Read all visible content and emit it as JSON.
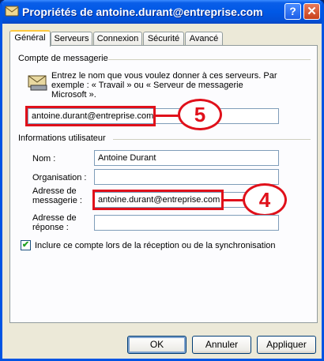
{
  "window": {
    "title": "Propriétés de antoine.durant@entreprise.com",
    "help_label": "?",
    "close_label": "✕"
  },
  "tabs": [
    "Général",
    "Serveurs",
    "Connexion",
    "Sécurité",
    "Avancé"
  ],
  "active_tab": "Général",
  "mail_account": {
    "group_label": "Compte de messagerie",
    "description": "Entrez le nom que vous voulez donner à ces serveurs. Par exemple : « Travail » ou « Serveur de messagerie Microsoft ».",
    "account_name": "antoine.durant@entreprise.com",
    "callout": "5"
  },
  "user_info": {
    "group_label": "Informations utilisateur",
    "name_label": "Nom :",
    "name_value": "Antoine Durant",
    "org_label": "Organisation :",
    "org_value": "",
    "email_label": "Adresse de messagerie :",
    "email_value": "antoine.durant@entreprise.com",
    "reply_label": "Adresse de réponse :",
    "reply_value": "",
    "callout": "4"
  },
  "include_checkbox": {
    "label": "Inclure ce compte lors de la réception ou de la synchronisation",
    "checked": true,
    "mark": "✔"
  },
  "buttons": {
    "ok": "OK",
    "cancel": "Annuler",
    "apply": "Appliquer"
  }
}
